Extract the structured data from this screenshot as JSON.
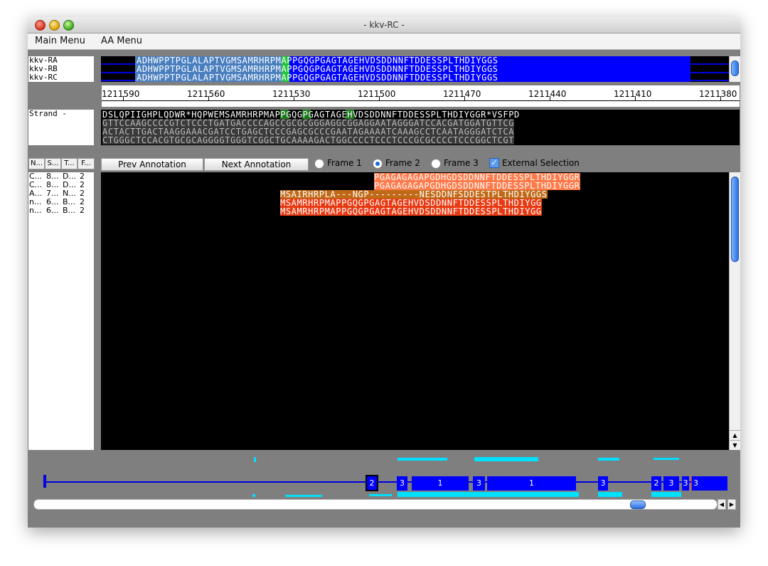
{
  "window": {
    "title": "- kkv-RC -"
  },
  "menu": {
    "main": "Main Menu",
    "aa": "AA Menu"
  },
  "transcripts": {
    "labels": [
      "kkv-RA",
      "kkv-RB",
      "kkv-RC"
    ],
    "seq_left": "ADHWPPTPGLALAPTVG",
    "seq_m": "M",
    "seq_right": "SAMRHRPMAPPGQGPGAGTAGEHVDSDDNNFTDDESSPLTHDIYGGS"
  },
  "ruler": {
    "ticks": [
      "1211590",
      "1211560",
      "1211530",
      "1211500",
      "1211470",
      "1211440",
      "1211410",
      "1211380"
    ]
  },
  "strand": {
    "label": "Strand -",
    "aa_line": "DSLQPIIGHPLQDWR*HQPWEMSAMRHRPMAPPGQGPGAGTAGEHVDSDDNNFTDDESSPLTHDIYGGR*VSFPD",
    "dna1": "GTTCCAAGCCCCGTCTCCCTGATGACCCCAGCCGCGCGGGAGGCGGAGGAATAGGGATCCACGATGGATGTTCG",
    "dna2": "ACTACTTGACTAAGGAAACGATCCTGAGCTCCCGAGCGCCCGAATAGAAAATCAAAGCCTCAATAGGGATCTCA",
    "dna3": "CTGGGCTCCACGTGCGCAGGGGTGGGTCGGCTGCAAAAGACTGGCCCCTCCCTCCCGCGCCCCTCCCGGCTCGT"
  },
  "controls": {
    "prev": "Prev Annotation",
    "next": "Next Annotation",
    "frame1": "Frame 1",
    "frame2": "Frame 2",
    "frame3": "Frame 3",
    "external": "External Selection",
    "check_mark": "✓"
  },
  "table": {
    "headers": [
      "N...",
      "S...",
      "T...",
      "F..."
    ],
    "rows": [
      [
        "C...",
        "8...",
        "D...",
        "2"
      ],
      [
        "C...",
        "8...",
        "D...",
        "2"
      ],
      [
        "A...",
        "7...",
        "N...",
        "2"
      ],
      [
        "n...",
        "6...",
        "B...",
        "2"
      ],
      [
        "n...",
        "6...",
        "B...",
        "2"
      ]
    ]
  },
  "alignments": [
    "PGAGAGAGAPGDHGDSDDNNFTDDESSPLTHDIYGGR",
    "PGAGAGAGAPGDHGDSDDNNFTDDESSPLTHDIYGGR",
    "MSAIRHRPLA---NGP---------NESDDNFSDDESTPLTHDIYGGS",
    "MSAMRHRPMAPPGQGPGAGTAGEHVDSDDNNFTDDESSPLTHDIYGG",
    "MSAMRHRPMAPPGQGPGAGTAGEHVDSDDNNFTDDESSPLTHDIYGG"
  ],
  "exon_labels": [
    "2",
    "3",
    "1",
    "3",
    "1",
    "3",
    "2",
    "3",
    "3",
    "3"
  ],
  "colors": {
    "blue": "#0000ff",
    "cyan": "#00e0ff",
    "orange": "#ff7a4a",
    "red": "#e83a12",
    "green": "#22c43a"
  }
}
